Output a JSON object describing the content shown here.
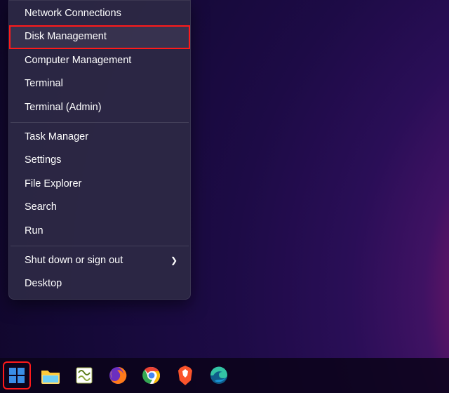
{
  "menu": {
    "items": [
      {
        "label": "Network Connections",
        "highlighted": false
      },
      {
        "label": "Disk Management",
        "highlighted": true
      },
      {
        "label": "Computer Management",
        "highlighted": false
      },
      {
        "label": "Terminal",
        "highlighted": false
      },
      {
        "label": "Terminal (Admin)",
        "highlighted": false
      }
    ],
    "items2": [
      {
        "label": "Task Manager"
      },
      {
        "label": "Settings"
      },
      {
        "label": "File Explorer"
      },
      {
        "label": "Search"
      },
      {
        "label": "Run"
      }
    ],
    "items3": [
      {
        "label": "Shut down or sign out",
        "submenu": true
      },
      {
        "label": "Desktop"
      }
    ]
  },
  "taskbar": {
    "items": [
      {
        "name": "start",
        "highlighted": true
      },
      {
        "name": "file-explorer"
      },
      {
        "name": "notepad-plus-plus"
      },
      {
        "name": "firefox"
      },
      {
        "name": "chrome"
      },
      {
        "name": "brave"
      },
      {
        "name": "edge"
      }
    ]
  },
  "colors": {
    "highlight": "#ff1a1a",
    "menu_bg": "#2c2844"
  }
}
